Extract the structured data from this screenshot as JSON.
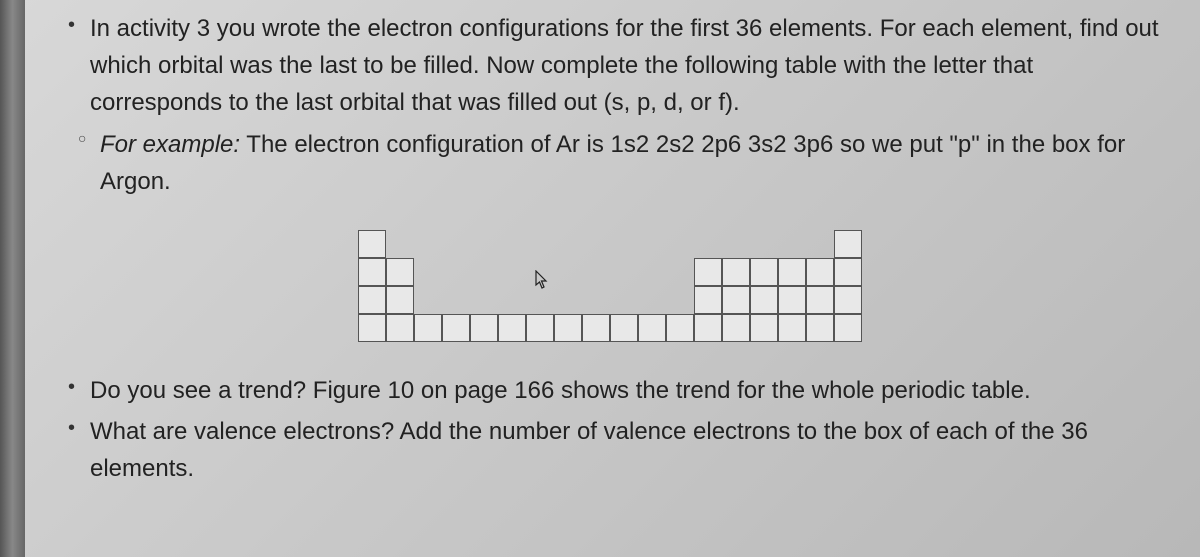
{
  "bullets": {
    "main1": "In activity 3 you wrote the electron configurations for the first 36 elements. For each element, find out which orbital was the last to be filled. Now complete the following table with the letter that corresponds to the last orbital that was filled out (s, p, d, or f).",
    "sub1_prefix": "For example:",
    "sub1_rest": " The electron configuration of Ar is 1s2 2s2 2p6 3s2 3p6 so we put \"p\" in the box for Argon.",
    "main2": "Do you see a trend? Figure 10 on page 166 shows the trend for the whole periodic table.",
    "main3": "What are valence electrons? Add the number of valence electrons to the box of each of the 36 elements."
  },
  "chart_data": {
    "type": "table",
    "title": "Periodic table outline (first 36 elements)",
    "rows": 4,
    "cols": 18,
    "layout": [
      [
        1,
        0,
        0,
        0,
        0,
        0,
        0,
        0,
        0,
        0,
        0,
        0,
        0,
        0,
        0,
        0,
        0,
        1
      ],
      [
        1,
        1,
        0,
        0,
        0,
        0,
        0,
        0,
        0,
        0,
        0,
        0,
        1,
        1,
        1,
        1,
        1,
        1
      ],
      [
        1,
        1,
        0,
        0,
        0,
        0,
        0,
        0,
        0,
        0,
        0,
        0,
        1,
        1,
        1,
        1,
        1,
        1
      ],
      [
        1,
        1,
        1,
        1,
        1,
        1,
        1,
        1,
        1,
        1,
        1,
        1,
        1,
        1,
        1,
        1,
        1,
        1
      ]
    ]
  }
}
